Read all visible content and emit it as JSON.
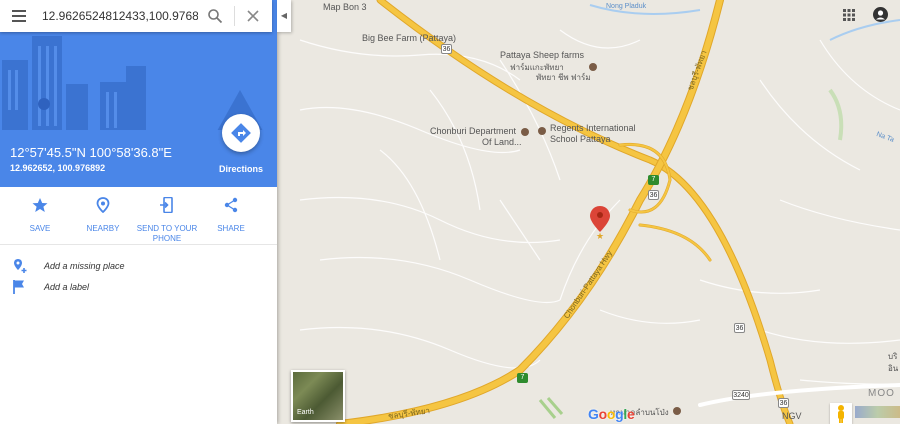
{
  "search": {
    "value": "12.9626524812433,100.976892",
    "placeholder": ""
  },
  "place": {
    "coords_dms": "12°57'45.5\"N 100°58'36.8\"E",
    "coords_decimal": "12.962652, 100.976892",
    "directions_label": "Directions"
  },
  "actions": [
    {
      "label": "SAVE",
      "icon": "star-icon"
    },
    {
      "label": "NEARBY",
      "icon": "nearby-icon"
    },
    {
      "label": "SEND TO YOUR PHONE",
      "icon": "send-to-phone-icon"
    },
    {
      "label": "SHARE",
      "icon": "share-icon"
    }
  ],
  "suggestions": [
    {
      "label": "Add a missing place",
      "icon": "add-place-icon"
    },
    {
      "label": "Add a label",
      "icon": "flag-icon"
    }
  ],
  "map": {
    "labels": {
      "map_bon": "Map Bon 3",
      "big_bee": "Big Bee Farm (Pattaya)",
      "sheep_en": "Pattaya Sheep farms",
      "sheep_th1": "ฟาร์มแกะพัทยา",
      "sheep_th2": "พัทยา ชีพ ฟาร์ม",
      "chonburi_dept1": "Chonburi Department",
      "chonburi_dept2": "Of Land...",
      "regents1": "Regents International",
      "regents2": "School Pattaya",
      "hwy": "Chonburi-Pattaya Hwy",
      "hwy_th_top": "ชลบุรี-พัทยา",
      "hwy_th_bottom": "ชลบุรี-พัทยา",
      "nong_pladuk": "Nong Pladuk",
      "na_ta": "Na Ta",
      "ngv": "NGV",
      "moo": "MOO",
      "thai_bottom": "ทุกนาคลำบนโป่ง",
      "thai_right1": "บริ",
      "thai_right2": "อิน"
    },
    "shields": {
      "s36a": "36",
      "s7a": "7",
      "s36b": "36",
      "s36c": "36",
      "s7b": "7",
      "s3240": "3240",
      "s36d": "36"
    },
    "earth_label": "Earth",
    "google_logo": [
      "G",
      "o",
      "o",
      "g",
      "l",
      "e"
    ]
  },
  "colors": {
    "accent": "#4a86e8",
    "highway": "#f5c542",
    "highway_edge": "#e0a72a",
    "pin": "#db4437",
    "background": "#ebe8e1"
  }
}
